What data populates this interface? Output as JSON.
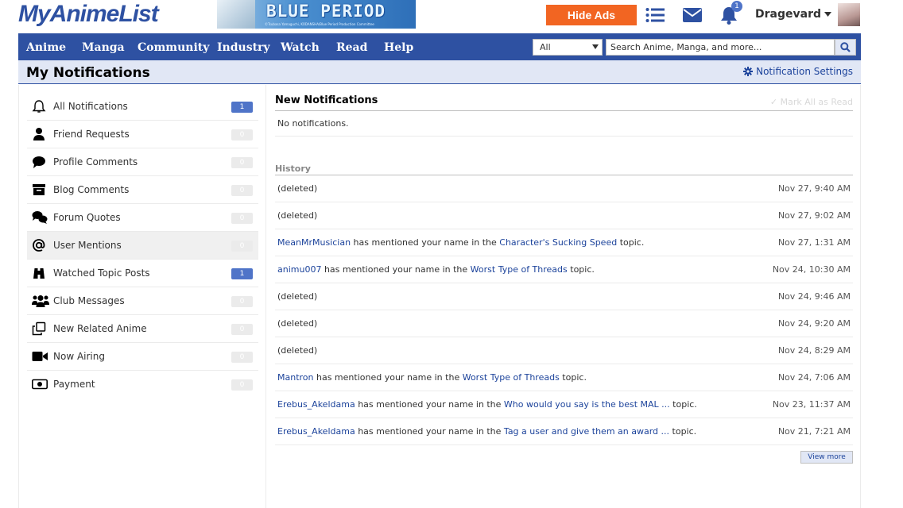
{
  "header": {
    "logo": "MyAnimeList",
    "banner_title": "BLUE PERIOD",
    "banner_sub": "©Tsubasa Yamaguchi, KODANSHA/Blue Period Production Committee",
    "hide_ads": "Hide Ads",
    "notifications_badge": "1",
    "username": "Dragevard"
  },
  "nav": {
    "items": [
      "Anime",
      "Manga",
      "Community",
      "Industry",
      "Watch",
      "Read",
      "Help"
    ],
    "search_filter": "All",
    "search_placeholder": "Search Anime, Manga, and more..."
  },
  "page": {
    "title": "My Notifications",
    "settings_label": "Notification Settings"
  },
  "sidebar": {
    "items": [
      {
        "label": "All Notifications",
        "count": "1",
        "icon": "bell-icon"
      },
      {
        "label": "Friend Requests",
        "count": "0",
        "icon": "user-icon"
      },
      {
        "label": "Profile Comments",
        "count": "0",
        "icon": "comment-icon"
      },
      {
        "label": "Blog Comments",
        "count": "0",
        "icon": "archive-icon"
      },
      {
        "label": "Forum Quotes",
        "count": "0",
        "icon": "comments-icon"
      },
      {
        "label": "User Mentions",
        "count": "0",
        "icon": "at-icon"
      },
      {
        "label": "Watched Topic Posts",
        "count": "1",
        "icon": "binoculars-icon"
      },
      {
        "label": "Club Messages",
        "count": "0",
        "icon": "users-icon"
      },
      {
        "label": "New Related Anime",
        "count": "0",
        "icon": "clone-icon"
      },
      {
        "label": "Now Airing",
        "count": "0",
        "icon": "video-icon"
      },
      {
        "label": "Payment",
        "count": "0",
        "icon": "money-icon"
      }
    ]
  },
  "main": {
    "new_title": "New Notifications",
    "mark_all": "Mark All as Read",
    "no_notifications": "No notifications.",
    "history_title": "History",
    "view_more": "View more",
    "history": [
      {
        "user": "",
        "middle": "(deleted)",
        "topic": "",
        "suffix": "",
        "time": "Nov 27, 9:40 AM"
      },
      {
        "user": "",
        "middle": "(deleted)",
        "topic": "",
        "suffix": "",
        "time": "Nov 27, 9:02 AM"
      },
      {
        "user": "MeanMrMusician",
        "middle": " has mentioned your name in the ",
        "topic": "Character's Sucking Speed",
        "suffix": " topic.",
        "time": "Nov 27, 1:31 AM"
      },
      {
        "user": "animu007",
        "middle": " has mentioned your name in the ",
        "topic": "Worst Type of Threads",
        "suffix": " topic.",
        "time": "Nov 24, 10:30 AM"
      },
      {
        "user": "",
        "middle": "(deleted)",
        "topic": "",
        "suffix": "",
        "time": "Nov 24, 9:46 AM"
      },
      {
        "user": "",
        "middle": "(deleted)",
        "topic": "",
        "suffix": "",
        "time": "Nov 24, 9:20 AM"
      },
      {
        "user": "",
        "middle": "(deleted)",
        "topic": "",
        "suffix": "",
        "time": "Nov 24, 8:29 AM"
      },
      {
        "user": "Mantron",
        "middle": " has mentioned your name in the ",
        "topic": "Worst Type of Threads",
        "suffix": " topic.",
        "time": "Nov 24, 7:06 AM"
      },
      {
        "user": "Erebus_Akeldama",
        "middle": " has mentioned your name in the ",
        "topic": "Who would you say is the best MAL ...",
        "suffix": " topic.",
        "time": "Nov 23, 11:37 AM"
      },
      {
        "user": "Erebus_Akeldama",
        "middle": " has mentioned your name in the ",
        "topic": "Tag a user and give them an award ...",
        "suffix": " topic.",
        "time": "Nov 21, 7:21 AM"
      }
    ]
  },
  "colors": {
    "brand": "#2e51a2",
    "accent": "#f26522",
    "badge": "#4f74c8",
    "header_bg": "#e1e7f5"
  }
}
